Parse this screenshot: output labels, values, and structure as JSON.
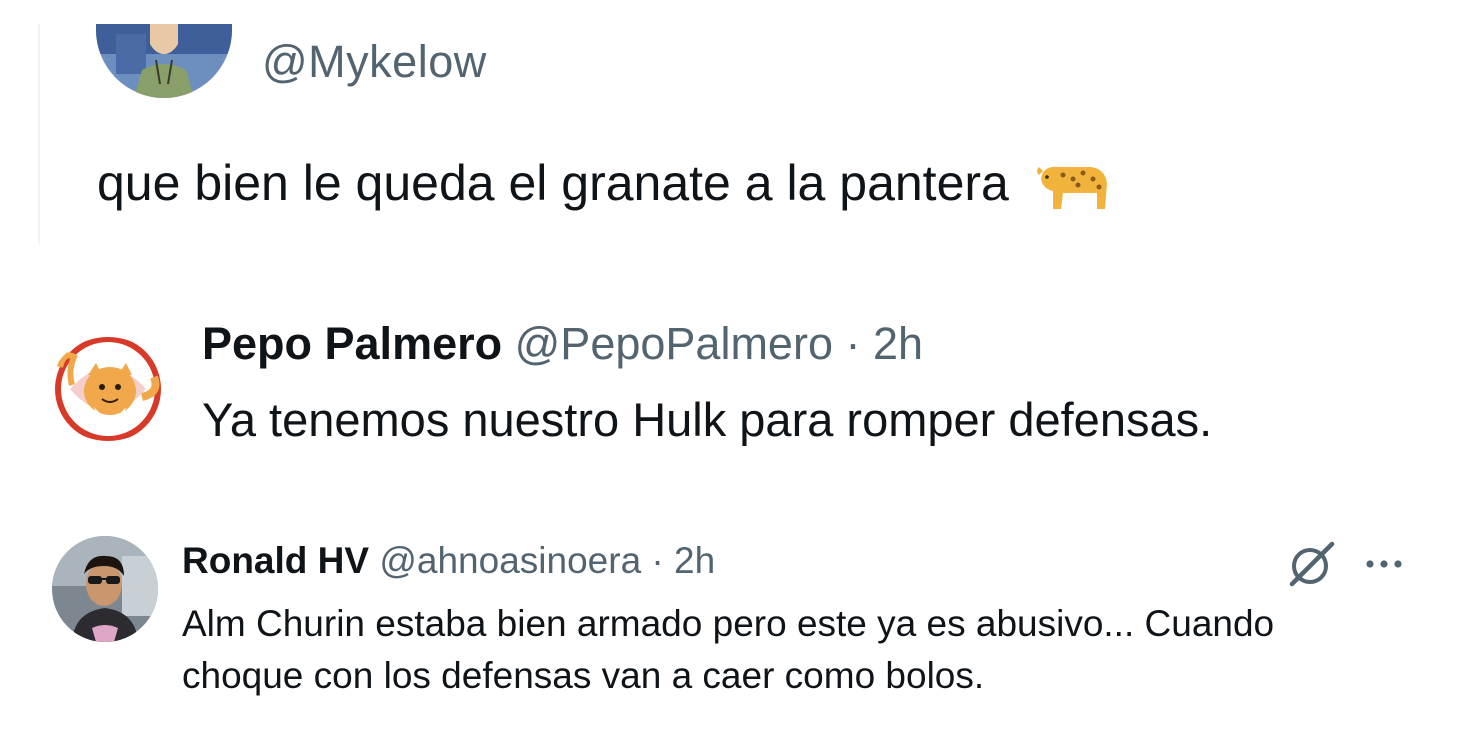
{
  "quoted_tweet": {
    "handle": "@Mykelow",
    "text": "que bien le queda el granate a la pantera",
    "emoji_icon": "leopard-emoji"
  },
  "reply_1": {
    "name": "Pepo Palmero",
    "handle": "@PepoPalmero",
    "separator": " · ",
    "time": "2h",
    "text": "Ya tenemos nuestro Hulk para romper defensas."
  },
  "reply_2": {
    "name": "Ronald HV",
    "handle": "@ahnoasinoera",
    "separator": " · ",
    "time": "2h",
    "line1": "Alm Churin estaba bien armado pero este ya es abusivo... Cuando",
    "line2": "choque con los defensas van a caer como bolos.",
    "grok_icon": "grok-icon",
    "more_icon": "more-icon"
  },
  "colors": {
    "text_primary": "#0f1419",
    "text_secondary": "#536471",
    "icon": "#536471"
  }
}
